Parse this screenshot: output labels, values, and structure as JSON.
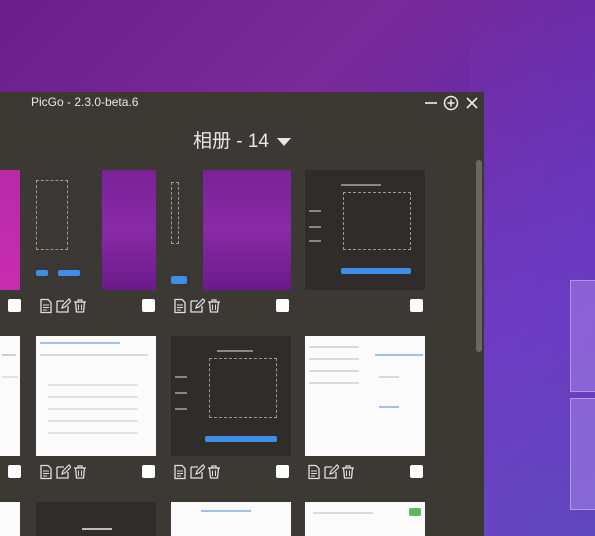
{
  "window": {
    "title": "PicGo - 2.3.0-beta.6"
  },
  "album": {
    "title": "相册 - 14"
  },
  "icons": {
    "minimize": "minus-icon",
    "maximize": "plus-circle-icon",
    "close": "close-icon",
    "copy": "document-icon",
    "edit": "edit-icon",
    "delete": "trash-icon",
    "dropdown": "caret-down-icon"
  },
  "colors": {
    "window_bg": "#3c3935",
    "accent_blue": "#3d8ee9",
    "thumb_purple": "#7a2198"
  }
}
